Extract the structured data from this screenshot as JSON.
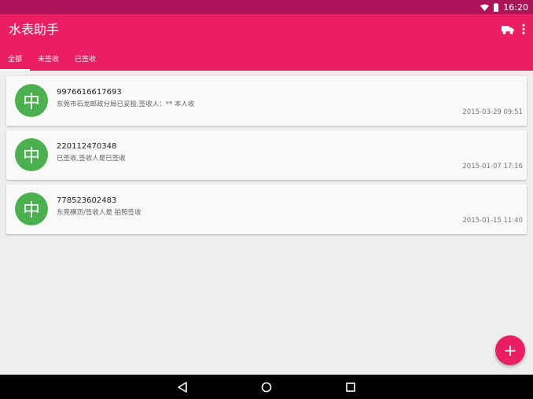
{
  "status_bar": {
    "time": "16:20",
    "icons": [
      "wifi-icon",
      "battery-icon"
    ]
  },
  "app_bar": {
    "title": "水表助手",
    "actions": [
      "truck-icon",
      "more-vert-icon"
    ],
    "color": "#e91e63",
    "status_color": "#ad1457"
  },
  "tabs": [
    {
      "label": "全部",
      "active": true
    },
    {
      "label": "未签收",
      "active": false
    },
    {
      "label": "已签收",
      "active": false
    }
  ],
  "items": [
    {
      "avatar": "中",
      "tracking": "9976616617693",
      "status": "东莞市石龙邮政分局已妥投,签收人：** 本人收",
      "time": "2015-03-29 09:51"
    },
    {
      "avatar": "中",
      "tracking": "220112470348",
      "status": "已签收,签收人是已签收",
      "time": "2015-01-07 17:16"
    },
    {
      "avatar": "中",
      "tracking": "778523602483",
      "status": "东莞横沥/签收人是 拍照签收",
      "time": "2015-01-15 11:40"
    }
  ],
  "avatar_color": "#4caf50",
  "fab": {
    "label": "+",
    "icon": "add-icon"
  },
  "nav_bar": {
    "buttons": [
      "back-icon",
      "home-icon",
      "recents-icon"
    ]
  }
}
